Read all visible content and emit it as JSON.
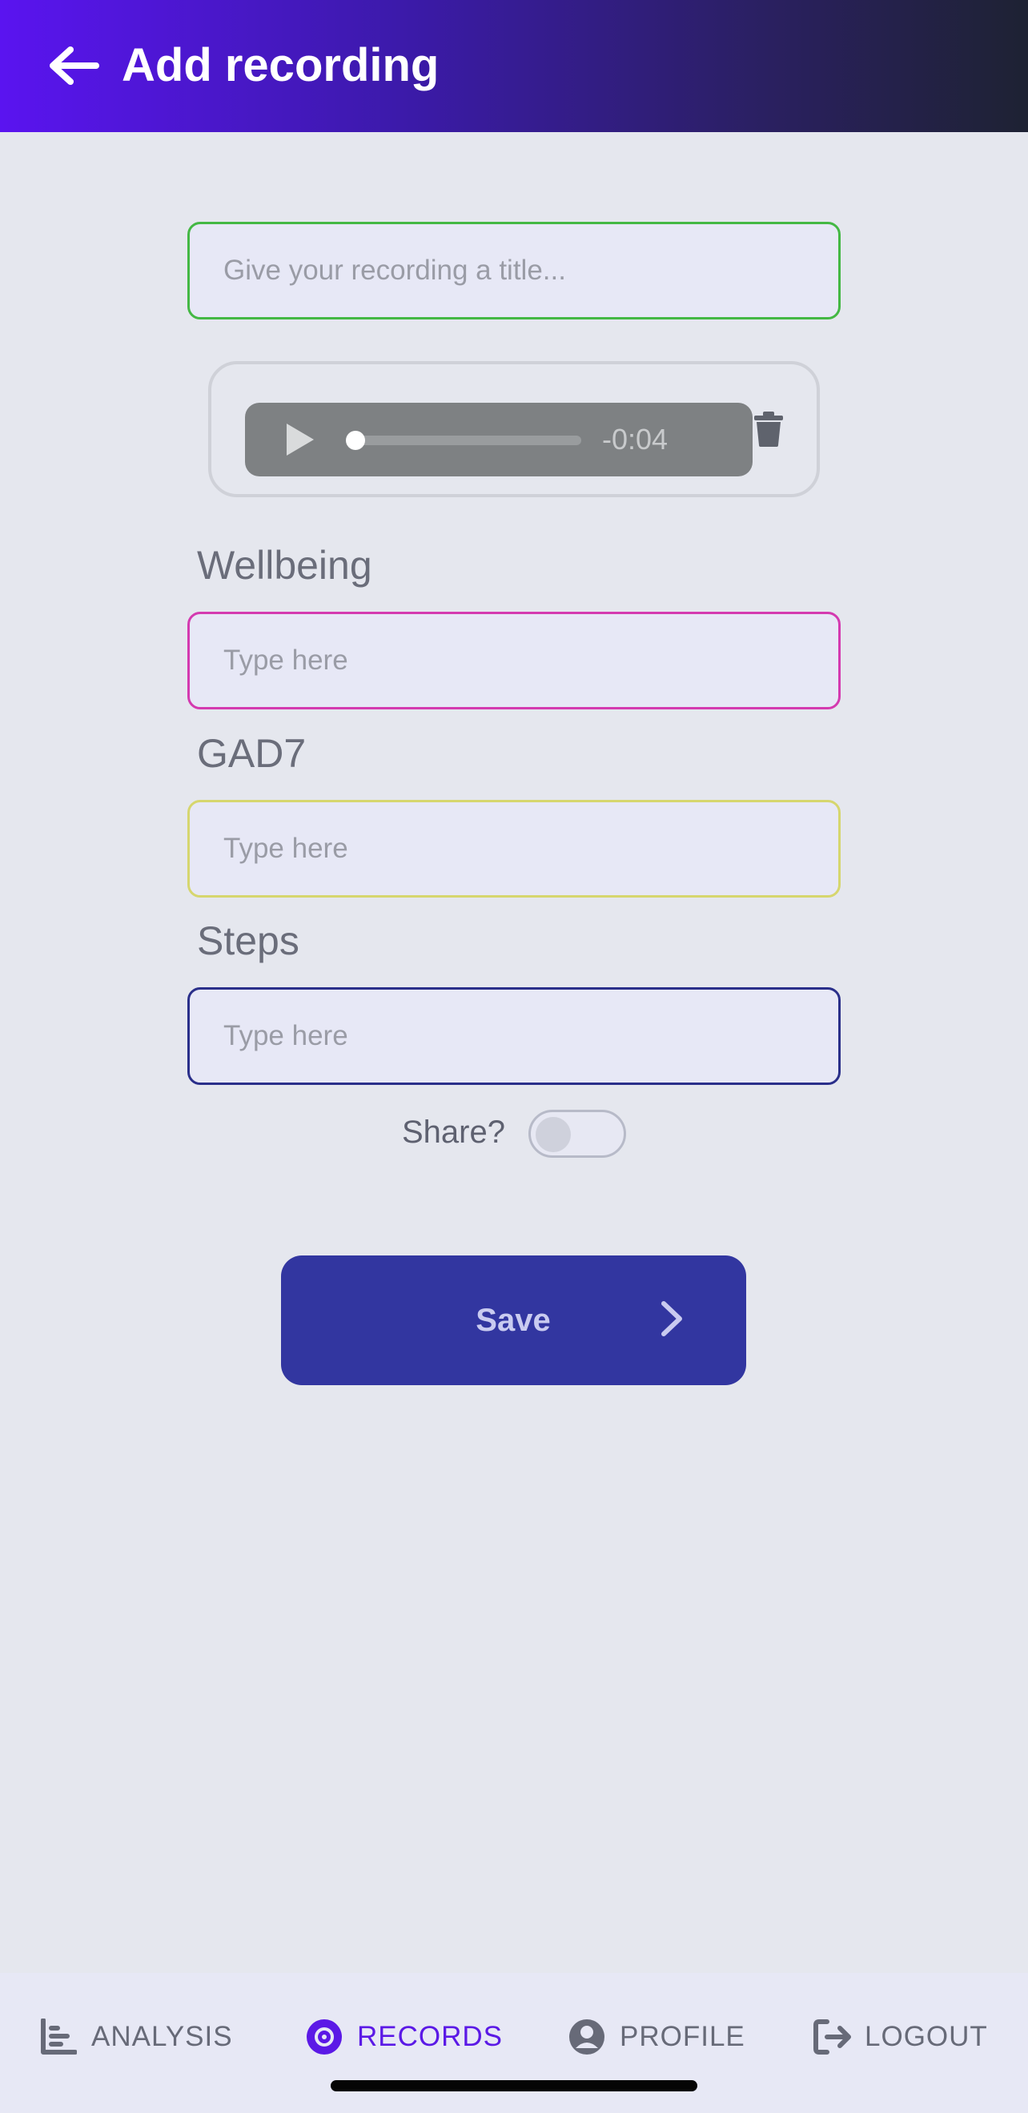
{
  "header": {
    "title": "Add recording",
    "back_icon": "arrow-left-icon"
  },
  "form": {
    "title_placeholder": "Give your recording a title...",
    "audio": {
      "time_remaining": "-0:04",
      "progress": 0.0
    },
    "fields": {
      "wellbeing": {
        "label": "Wellbeing",
        "placeholder": "Type here",
        "border_color": "#d43ab0"
      },
      "gad7": {
        "label": "GAD7",
        "placeholder": "Type here",
        "border_color": "#d6d66e"
      },
      "steps": {
        "label": "Steps",
        "placeholder": "Type here",
        "border_color": "#2a2f8a"
      }
    },
    "share_label": "Share?",
    "share_on": false,
    "save_label": "Save"
  },
  "bottom_nav": {
    "items": [
      {
        "label": "ANALYSIS",
        "icon": "bar-chart-icon",
        "active": false
      },
      {
        "label": "RECORDS",
        "icon": "disc-icon",
        "active": true
      },
      {
        "label": "PROFILE",
        "icon": "user-circle-icon",
        "active": false
      },
      {
        "label": "LOGOUT",
        "icon": "logout-icon",
        "active": false
      }
    ]
  },
  "colors": {
    "header_start": "#5a14f0",
    "header_end": "#1e2233",
    "save_button": "#3236a0",
    "active_nav": "#5b19e6",
    "title_border": "#44b844"
  }
}
